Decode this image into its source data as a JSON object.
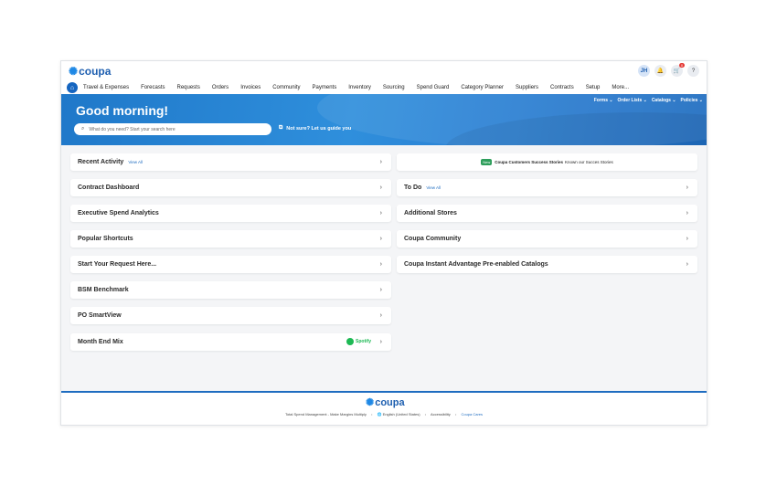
{
  "brand": {
    "name": "coupa",
    "icon": "coupa-burst-logo"
  },
  "header": {
    "avatar_initials": "JH",
    "notification_icon": "bell-icon",
    "cart_icon": "cart-icon",
    "cart_count": "0",
    "help_label": "?"
  },
  "nav": {
    "home_icon": "home-icon",
    "items": [
      "Travel & Expenses",
      "Forecasts",
      "Requests",
      "Orders",
      "Invoices",
      "Community",
      "Payments",
      "Inventory",
      "Sourcing",
      "Spend Guard",
      "Category Planner",
      "Suppliers",
      "Contracts",
      "Setup",
      "More..."
    ]
  },
  "hero": {
    "greeting": "Good morning!",
    "search_placeholder": "What do you need? Start your search here",
    "not_sure": "Not sure? Let us guide you",
    "subnav": [
      "Forms ⌄",
      "Order Lists ⌄",
      "Catalogs ⌄",
      "Policies ⌄"
    ]
  },
  "left_cards": [
    {
      "label": "Recent Activity",
      "view_all": "View All"
    },
    {
      "label": "Contract Dashboard"
    },
    {
      "label": "Executive Spend Analytics"
    },
    {
      "label": "Popular Shortcuts"
    },
    {
      "label": "Start Your Request Here..."
    },
    {
      "label": "BSM Benchmark"
    },
    {
      "label": "PO SmartView"
    },
    {
      "label": "Month End Mix",
      "badge": "Spotify"
    }
  ],
  "success_card": {
    "tag": "New",
    "title": "Coupa Customers Success Stories",
    "subtitle": "Known our Succes Stories"
  },
  "right_cards": [
    {
      "label": "To Do",
      "view_all": "View All"
    },
    {
      "label": "Additional Stores"
    },
    {
      "label": "Coupa Community"
    },
    {
      "label": "Coupa Instant Advantage Pre-enabled Catalogs"
    }
  ],
  "footer": {
    "tagline": "Total Spend Management - Make Margins Multiply",
    "language": "English (United States)",
    "accessibility": "Accessibility",
    "cares": "Coupa Cares"
  },
  "colors": {
    "primary": "#1e6cc0",
    "accent": "#1e88e5",
    "spotify": "#1db954",
    "background": "#f4f5f7"
  }
}
